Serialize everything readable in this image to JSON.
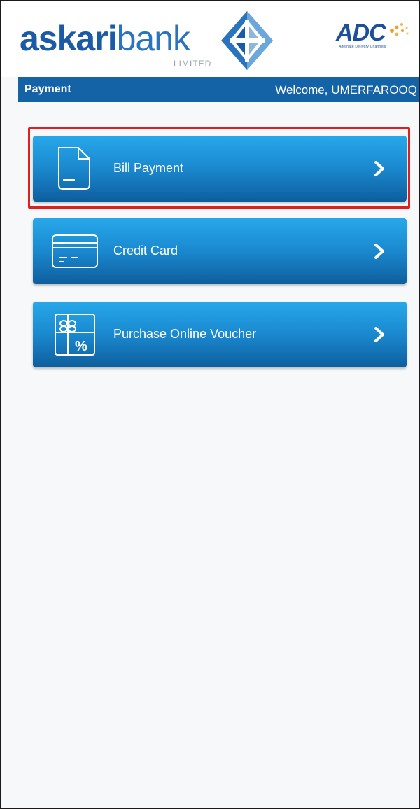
{
  "header": {
    "brand_bold": "askari",
    "brand_light": "bank",
    "brand_sub": "LIMITED",
    "partner_logo": "ADC",
    "partner_sub": "Alternate Delivery Channels"
  },
  "titlebar": {
    "title": "Payment",
    "welcome": "Welcome, UMERFAROOQ"
  },
  "menu": [
    {
      "label": "Bill Payment",
      "icon": "document-icon",
      "highlighted": true
    },
    {
      "label": "Credit Card",
      "icon": "credit-card-icon"
    },
    {
      "label": "Purchase Online Voucher",
      "icon": "gift-voucher-icon"
    }
  ],
  "colors": {
    "brand_blue": "#1b5aa6",
    "titlebar": "#1463a6",
    "button_top": "#27a8ea",
    "button_bottom": "#0e5e9d",
    "highlight": "#e21f1f"
  }
}
